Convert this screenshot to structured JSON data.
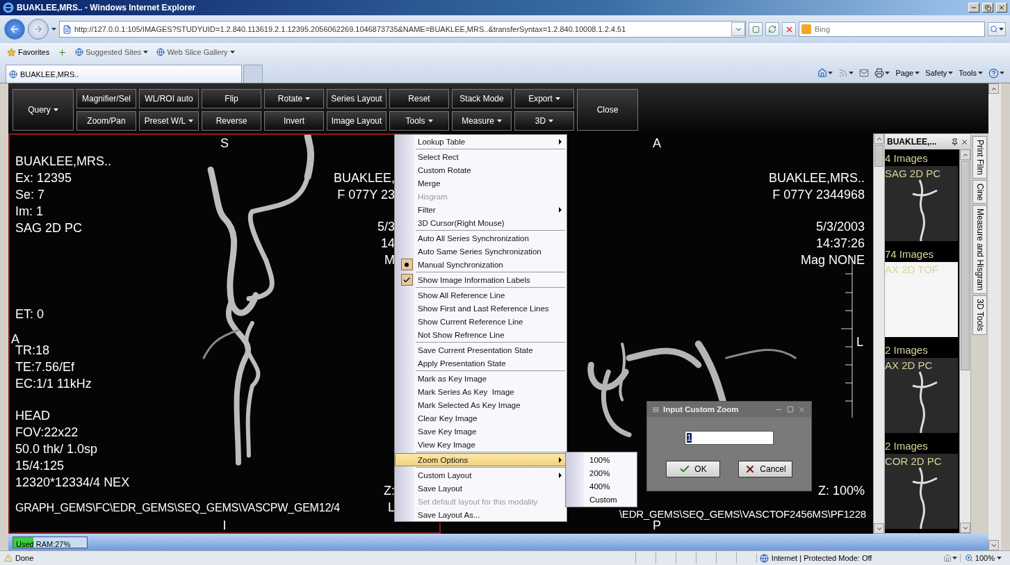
{
  "window": {
    "title": "BUAKLEE,MRS.. - Windows Internet Explorer"
  },
  "address_bar": {
    "url": "http://127.0.0.1:105/IMAGES?STUDYUID=1.2.840.113619.2.1.12395.2056062269.1046873735&NAME=BUAKLEE,MRS..&transferSyntax=1.2.840.10008.1.2.4.51"
  },
  "search": {
    "placeholder": "Bing"
  },
  "favorites_bar": {
    "label": "Favorites",
    "items": [
      {
        "label": "Suggested Sites"
      },
      {
        "label": "Web Slice Gallery"
      }
    ]
  },
  "tabs": [
    {
      "label": "BUAKLEE,MRS..",
      "selected": true
    }
  ],
  "command_bar": [
    "Page",
    "Safety",
    "Tools"
  ],
  "toolbar": {
    "query": {
      "label": "Query",
      "dropdown": true
    },
    "columns": [
      {
        "top": {
          "label": "Magnifier/Sel",
          "dropdown": false
        },
        "bottom": {
          "label": "Zoom/Pan",
          "dropdown": false
        }
      },
      {
        "top": {
          "label": "WL/ROI auto",
          "dropdown": false
        },
        "bottom": {
          "label": "Preset W/L",
          "dropdown": true
        }
      },
      {
        "top": {
          "label": "Flip",
          "dropdown": false
        },
        "bottom": {
          "label": "Reverse",
          "dropdown": false
        }
      },
      {
        "top": {
          "label": "Rotate",
          "dropdown": true
        },
        "bottom": {
          "label": "Invert",
          "dropdown": false
        }
      },
      {
        "top": {
          "label": "Series Layout",
          "dropdown": false
        },
        "bottom": {
          "label": "Image Layout",
          "dropdown": false
        }
      },
      {
        "top": {
          "label": "Reset",
          "dropdown": false
        },
        "bottom": {
          "label": "Tools",
          "dropdown": true
        }
      },
      {
        "top": {
          "label": "Stack Mode",
          "dropdown": false
        },
        "bottom": {
          "label": "Measure",
          "dropdown": true
        }
      },
      {
        "top": {
          "label": "Export",
          "dropdown": true
        },
        "bottom": {
          "label": "3D",
          "dropdown": true
        }
      }
    ],
    "close": {
      "label": "Close"
    }
  },
  "viewports": [
    {
      "selected": true,
      "top": "S",
      "bottom": "I",
      "left": "A",
      "left_groups": [
        [
          "BUAKLEE,MRS..",
          "Ex: 12395",
          "Se: 7",
          "Im: 1",
          "SAG 2D PC"
        ],
        [
          "ET: 0"
        ],
        [
          "TR:18",
          "TE:7.56/Ef",
          "EC:1/1 11kHz"
        ],
        [
          "HEAD",
          "FOV:22x22",
          "50.0 thk/ 1.0sp",
          "15/4:125",
          "12320*12334/4 NEX"
        ]
      ],
      "right_groups": [
        [
          "BUAKLEE,",
          "F 077Y 23"
        ],
        [
          "5/3",
          "14",
          "M"
        ]
      ],
      "zoom": "Z:",
      "path": "GRAPH_GEMS\\FC\\EDR_GEMS\\SEQ_GEMS\\VASCPW_GEM12/4",
      "path_end": "L"
    },
    {
      "selected": false,
      "top": "A",
      "bottom": "P",
      "right": "L",
      "right_groups": [
        [
          "BUAKLEE,MRS..",
          "F 077Y 2344968"
        ],
        [
          "5/3/2003",
          "14:37:26",
          "Mag NONE"
        ]
      ],
      "zoom": "Z: 100%",
      "path": "\\EDR_GEMS\\SEQ_GEMS\\VASCTOF2456MS\\PF1228"
    }
  ],
  "series_panel": {
    "title": "BUAKLEE,...",
    "series": [
      {
        "count": "4 Images",
        "name": "SAG 2D PC"
      },
      {
        "count": "74 Images",
        "name": "AX 2D TOF"
      },
      {
        "count": "2 Images",
        "name": "AX 2D PC"
      },
      {
        "count": "2 Images",
        "name": "COR 2D PC"
      }
    ]
  },
  "side_tabs": [
    "Print Film",
    "Cine",
    "Measure and Hisgram",
    "3D Tools"
  ],
  "ram": {
    "label": "Used RAM:27%",
    "level": 0.27
  },
  "context_menu": {
    "groups": [
      [
        {
          "label": "Lookup Table",
          "kind": "submenu",
          "disabled": false,
          "selected": false
        }
      ],
      [
        {
          "label": "Select Rect",
          "kind": "command",
          "disabled": false,
          "selected": false
        },
        {
          "label": "Custom Rotate",
          "kind": "command",
          "disabled": false,
          "selected": false
        },
        {
          "label": "Merge",
          "kind": "command",
          "disabled": false,
          "selected": false
        },
        {
          "label": "Hisgram",
          "kind": "command",
          "disabled": true,
          "selected": false
        },
        {
          "label": "Filter",
          "kind": "submenu",
          "disabled": false,
          "selected": false
        },
        {
          "label": "3D Cursor(Right Mouse)",
          "kind": "command",
          "disabled": false,
          "selected": false
        }
      ],
      [
        {
          "label": "Auto All Series Synchronization",
          "kind": "command",
          "disabled": false,
          "selected": false
        },
        {
          "label": "Auto Same Series Synchronization",
          "kind": "command",
          "disabled": false,
          "selected": false
        },
        {
          "label": "Manual Synchronization",
          "kind": "radio",
          "checked": true,
          "disabled": false,
          "selected": false
        }
      ],
      [
        {
          "label": "Show Image Information Labels",
          "kind": "check",
          "checked": true,
          "disabled": false,
          "selected": false
        }
      ],
      [
        {
          "label": "Show All Reference Line",
          "kind": "command",
          "disabled": false,
          "selected": false
        },
        {
          "label": "Show First and Last Reference Lines",
          "kind": "command",
          "disabled": false,
          "selected": false
        },
        {
          "label": "Show Current Reference Line",
          "kind": "command",
          "disabled": false,
          "selected": false
        },
        {
          "label": "Not Show Refrence Line",
          "kind": "command",
          "disabled": false,
          "selected": false
        }
      ],
      [
        {
          "label": "Save Current Presentation State",
          "kind": "command",
          "disabled": false,
          "selected": false
        },
        {
          "label": "Apply Presentation State",
          "kind": "command",
          "disabled": false,
          "selected": false
        }
      ],
      [
        {
          "label": "Mark as Key Image",
          "kind": "command",
          "disabled": false,
          "selected": false
        },
        {
          "label": "Mark Series As Key  Image",
          "kind": "command",
          "disabled": false,
          "selected": false
        },
        {
          "label": "Mark Selected As Key Image",
          "kind": "command",
          "disabled": false,
          "selected": false
        },
        {
          "label": "Clear Key Image",
          "kind": "command",
          "disabled": false,
          "selected": false
        },
        {
          "label": "Save Key Image",
          "kind": "command",
          "disabled": false,
          "selected": false
        },
        {
          "label": "View Key Image",
          "kind": "command",
          "disabled": false,
          "selected": false
        }
      ],
      [
        {
          "label": "Zoom Options",
          "kind": "submenu",
          "disabled": false,
          "selected": true
        }
      ],
      [
        {
          "label": "Custom Layout",
          "kind": "submenu",
          "disabled": false,
          "selected": false
        },
        {
          "label": "Save Layout",
          "kind": "command",
          "disabled": false,
          "selected": false
        },
        {
          "label": "Set default layout for this modality",
          "kind": "command",
          "disabled": true,
          "selected": false
        },
        {
          "label": "Save Layout As...",
          "kind": "command",
          "disabled": false,
          "selected": false
        }
      ]
    ]
  },
  "submenu": {
    "items": [
      "100%",
      "200%",
      "400%",
      "Custom"
    ]
  },
  "dialog": {
    "title": "Input Custom Zoom",
    "value": "1",
    "buttons": [
      {
        "label": "OK",
        "kind": "ok"
      },
      {
        "label": "Cancel",
        "kind": "cancel"
      }
    ]
  },
  "status_bar": {
    "text": "Done",
    "zone": "Internet | Protected Mode: Off",
    "zoom": "100%"
  }
}
